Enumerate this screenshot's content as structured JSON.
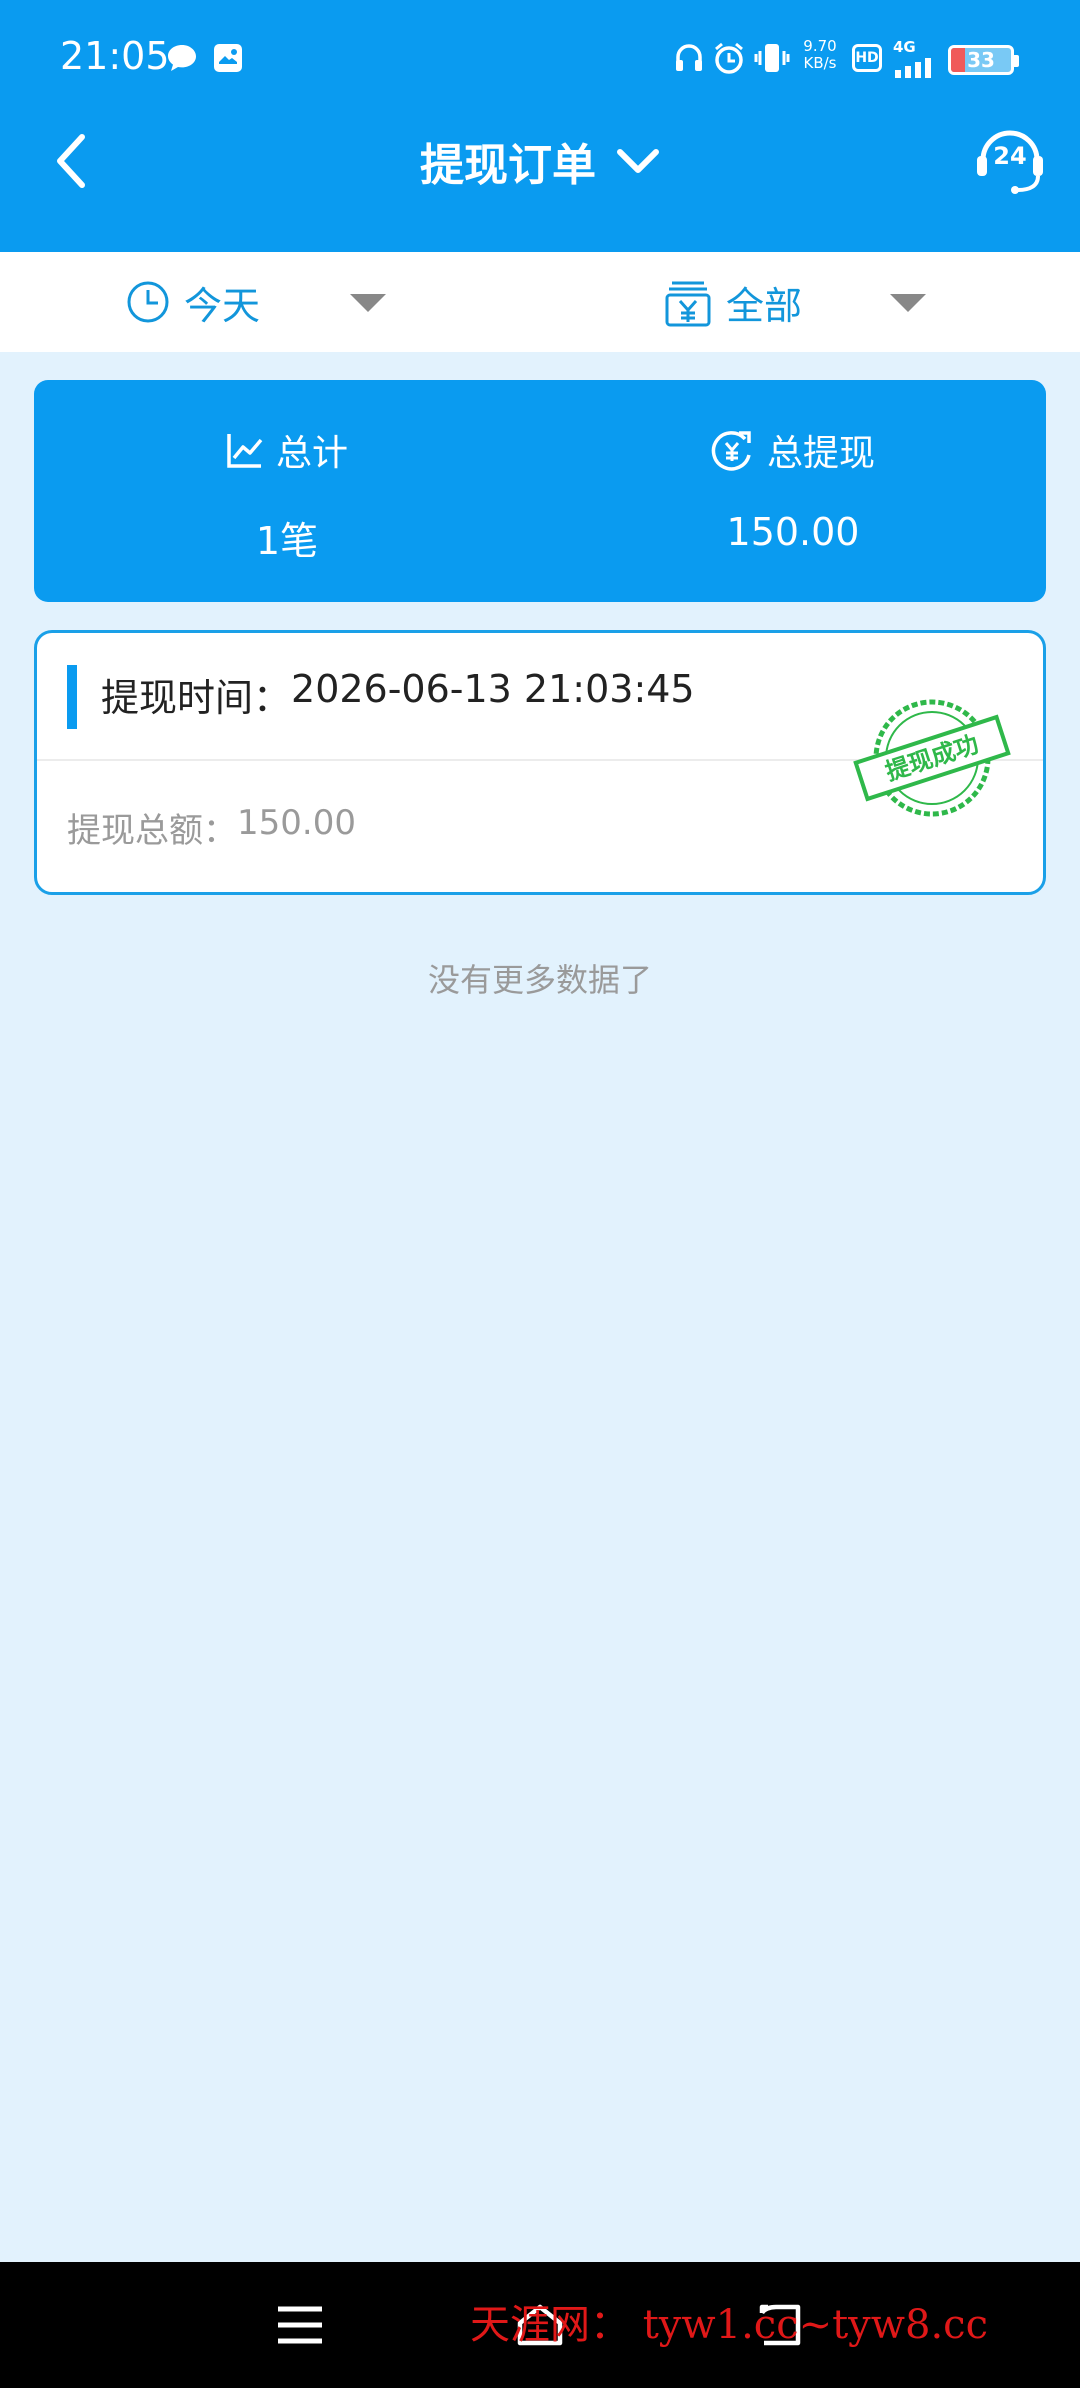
{
  "status_bar": {
    "time": "21:05",
    "speed_value": "9.70",
    "speed_unit": "KB/s",
    "hd": "HD",
    "network": "4G",
    "battery": "33"
  },
  "nav": {
    "title": "提现订单",
    "icons": [
      "chevron-left-icon",
      "chevron-down-icon",
      "support-24h-icon"
    ],
    "support_label": "24"
  },
  "filters": {
    "date": {
      "label": "今天",
      "icon": "clock-icon"
    },
    "type": {
      "label": "全部",
      "icon": "yuan-box-icon"
    }
  },
  "summary": {
    "total_label": "总计",
    "total_value": "1笔",
    "withdraw_label": "总提现",
    "withdraw_value": "150.00"
  },
  "orders": [
    {
      "time_label": "提现时间：",
      "time_value": "2026-06-13 21:03:45",
      "amount_label": "提现总额：",
      "amount_value": "150.00",
      "stamp_text": "提现成功"
    }
  ],
  "list_footer": "没有更多数据了",
  "bottom_nav": {
    "icons": [
      "menu-icon",
      "home-icon",
      "back-icon"
    ],
    "watermark": "天涯网： tyw1.cc~tyw8.cc"
  },
  "colors": {
    "primary": "#0a9bf0",
    "background": "#e2f2fd",
    "stamp": "#2fb84a"
  }
}
